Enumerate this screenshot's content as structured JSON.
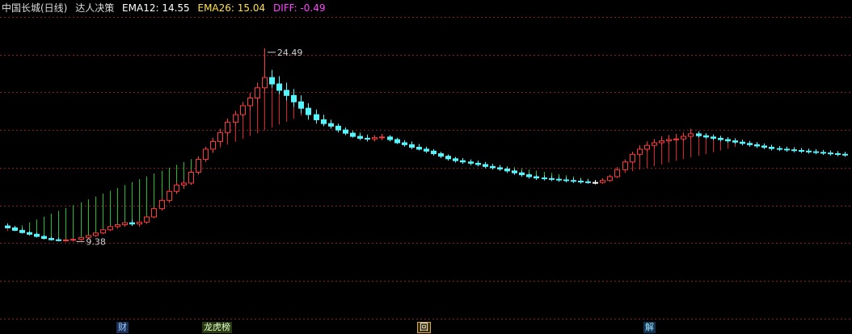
{
  "header": {
    "stock_name": "中国长城(日线)",
    "indicator_name": "达人决策",
    "ema12_text": "EMA12: 14.55",
    "ema26_text": "EMA26: 15.04",
    "diff_text": "DIFF: -0.49",
    "colors": {
      "name": "#dcdcdc",
      "ema12": "#ffffff",
      "ema26": "#ffe14d",
      "diff": "#ff44ff"
    }
  },
  "events": {
    "cai": "财",
    "bang": "龙虎榜",
    "hui": "回",
    "jie": "解"
  },
  "chart_data": {
    "type": "candlestick",
    "grid": true,
    "colors": {
      "up": "#ff3b3b",
      "down": "#54f7ff",
      "flat": "#ffffff",
      "ema_bull": "#e02020",
      "ema_bear": "#20c020",
      "grid": "#8a1e1e",
      "background": "#000000"
    },
    "ylim": [
      3.35,
      27.0
    ],
    "annotations": [
      {
        "label": "24.49",
        "index": 35,
        "value": 24.49
      },
      {
        "label": "9.38",
        "index": 9,
        "value": 9.38
      }
    ],
    "candles": [
      [
        10.6,
        10.8,
        10.4,
        10.45
      ],
      [
        10.45,
        10.6,
        10.2,
        10.25
      ],
      [
        10.25,
        10.4,
        10.0,
        10.08
      ],
      [
        10.08,
        10.2,
        9.85,
        9.95
      ],
      [
        9.95,
        10.1,
        9.7,
        9.78
      ],
      [
        9.78,
        9.9,
        9.55,
        9.62
      ],
      [
        9.62,
        9.75,
        9.45,
        9.52
      ],
      [
        9.52,
        9.7,
        9.4,
        9.45
      ],
      [
        9.45,
        9.62,
        9.38,
        9.5
      ],
      [
        9.5,
        9.65,
        9.38,
        9.55
      ],
      [
        9.55,
        9.75,
        9.45,
        9.7
      ],
      [
        9.7,
        9.9,
        9.6,
        9.85
      ],
      [
        9.85,
        10.1,
        9.75,
        10.05
      ],
      [
        10.05,
        10.4,
        9.95,
        10.3
      ],
      [
        10.3,
        10.6,
        10.2,
        10.55
      ],
      [
        10.55,
        10.8,
        10.4,
        10.7
      ],
      [
        10.7,
        10.95,
        10.55,
        10.85
      ],
      [
        10.85,
        11.1,
        10.6,
        10.75
      ],
      [
        10.75,
        11.0,
        10.55,
        10.9
      ],
      [
        10.9,
        11.4,
        10.75,
        11.3
      ],
      [
        11.3,
        12.1,
        11.2,
        11.95
      ],
      [
        11.95,
        12.8,
        11.8,
        12.6
      ],
      [
        12.6,
        13.5,
        12.4,
        13.3
      ],
      [
        13.3,
        14.0,
        13.1,
        13.8
      ],
      [
        13.8,
        14.2,
        13.5,
        13.95
      ],
      [
        13.95,
        15.0,
        13.8,
        14.8
      ],
      [
        14.8,
        16.0,
        14.6,
        15.8
      ],
      [
        15.8,
        16.8,
        15.6,
        16.6
      ],
      [
        16.6,
        17.5,
        16.3,
        17.2
      ],
      [
        17.2,
        18.2,
        16.9,
        17.9
      ],
      [
        17.9,
        19.0,
        17.6,
        18.7
      ],
      [
        18.7,
        19.6,
        18.4,
        19.3
      ],
      [
        19.3,
        20.3,
        19.0,
        20.0
      ],
      [
        20.0,
        21.0,
        19.6,
        20.6
      ],
      [
        20.6,
        21.8,
        20.2,
        21.4
      ],
      [
        21.4,
        24.49,
        21.0,
        22.2
      ],
      [
        22.2,
        22.8,
        21.4,
        21.7
      ],
      [
        21.7,
        22.3,
        20.9,
        21.2
      ],
      [
        21.2,
        21.8,
        20.4,
        20.8
      ],
      [
        20.8,
        21.3,
        19.9,
        20.3
      ],
      [
        20.3,
        20.8,
        19.4,
        19.8
      ],
      [
        19.8,
        20.2,
        18.9,
        19.3
      ],
      [
        19.3,
        19.7,
        18.6,
        18.9
      ],
      [
        18.9,
        19.3,
        18.4,
        18.6
      ],
      [
        18.6,
        18.9,
        18.2,
        18.4
      ],
      [
        18.4,
        18.6,
        17.9,
        18.1
      ],
      [
        18.1,
        18.3,
        17.7,
        17.85
      ],
      [
        17.85,
        18.0,
        17.5,
        17.6
      ],
      [
        17.6,
        17.8,
        17.3,
        17.45
      ],
      [
        17.45,
        17.7,
        17.2,
        17.4
      ],
      [
        17.4,
        17.7,
        17.2,
        17.5
      ],
      [
        17.5,
        17.8,
        17.3,
        17.55
      ],
      [
        17.55,
        17.7,
        17.2,
        17.35
      ],
      [
        17.35,
        17.5,
        17.0,
        17.1
      ],
      [
        17.1,
        17.3,
        16.8,
        16.95
      ],
      [
        16.95,
        17.2,
        16.6,
        16.75
      ],
      [
        16.75,
        17.0,
        16.5,
        16.6
      ],
      [
        16.6,
        16.8,
        16.3,
        16.45
      ],
      [
        16.45,
        16.6,
        16.1,
        16.25
      ],
      [
        16.25,
        16.4,
        15.9,
        16.05
      ],
      [
        16.05,
        16.2,
        15.7,
        15.85
      ],
      [
        15.85,
        16.0,
        15.55,
        15.7
      ],
      [
        15.7,
        15.9,
        15.45,
        15.6
      ],
      [
        15.6,
        15.8,
        15.35,
        15.5
      ],
      [
        15.5,
        15.7,
        15.25,
        15.4
      ],
      [
        15.4,
        15.6,
        15.1,
        15.25
      ],
      [
        15.25,
        15.45,
        15.0,
        15.15
      ],
      [
        15.15,
        15.35,
        14.9,
        15.05
      ],
      [
        15.05,
        15.2,
        14.75,
        14.9
      ],
      [
        14.9,
        15.05,
        14.6,
        14.75
      ],
      [
        14.75,
        14.9,
        14.45,
        14.6
      ],
      [
        14.6,
        14.75,
        14.3,
        14.45
      ],
      [
        14.45,
        14.6,
        14.2,
        14.35
      ],
      [
        14.35,
        14.55,
        14.15,
        14.3
      ],
      [
        14.3,
        14.5,
        14.1,
        14.25
      ],
      [
        14.25,
        14.45,
        14.05,
        14.2
      ],
      [
        14.2,
        14.4,
        14.0,
        14.15
      ],
      [
        14.15,
        14.35,
        13.95,
        14.1
      ],
      [
        14.1,
        14.3,
        13.9,
        14.05
      ],
      [
        14.05,
        14.25,
        13.9,
        14.0
      ],
      [
        14.0,
        14.2,
        13.85,
        14.0
      ],
      [
        14.0,
        14.3,
        13.9,
        14.15
      ],
      [
        14.15,
        14.6,
        14.05,
        14.45
      ],
      [
        14.45,
        15.2,
        14.35,
        15.0
      ],
      [
        15.0,
        15.8,
        14.9,
        15.6
      ],
      [
        15.6,
        16.4,
        15.5,
        16.2
      ],
      [
        16.2,
        16.9,
        16.0,
        16.6
      ],
      [
        16.6,
        17.2,
        16.4,
        16.9
      ],
      [
        16.9,
        17.4,
        16.7,
        17.1
      ],
      [
        17.1,
        17.6,
        16.9,
        17.25
      ],
      [
        17.25,
        17.7,
        17.0,
        17.35
      ],
      [
        17.35,
        17.8,
        17.1,
        17.4
      ],
      [
        17.4,
        17.9,
        17.2,
        17.6
      ],
      [
        17.6,
        18.2,
        17.4,
        17.8
      ],
      [
        17.8,
        18.0,
        17.5,
        17.65
      ],
      [
        17.65,
        17.85,
        17.4,
        17.55
      ],
      [
        17.55,
        17.75,
        17.3,
        17.45
      ],
      [
        17.45,
        17.65,
        17.2,
        17.35
      ],
      [
        17.35,
        17.55,
        17.1,
        17.25
      ],
      [
        17.25,
        17.45,
        17.0,
        17.15
      ],
      [
        17.15,
        17.35,
        16.9,
        17.05
      ],
      [
        17.05,
        17.25,
        16.8,
        16.95
      ],
      [
        16.95,
        17.15,
        16.7,
        16.85
      ],
      [
        16.85,
        17.05,
        16.6,
        16.75
      ],
      [
        16.75,
        16.95,
        16.5,
        16.65
      ],
      [
        16.65,
        16.85,
        16.45,
        16.6
      ],
      [
        16.6,
        16.8,
        16.4,
        16.55
      ],
      [
        16.55,
        16.75,
        16.35,
        16.5
      ],
      [
        16.5,
        16.7,
        16.3,
        16.45
      ],
      [
        16.45,
        16.65,
        16.25,
        16.4
      ],
      [
        16.4,
        16.6,
        16.2,
        16.35
      ],
      [
        16.35,
        16.55,
        16.15,
        16.3
      ],
      [
        16.3,
        16.5,
        16.1,
        16.25
      ],
      [
        16.25,
        16.45,
        16.05,
        16.2
      ],
      [
        16.2,
        16.4,
        16.0,
        16.15
      ]
    ],
    "ema": [
      {
        "x": 0,
        "y": 10.2,
        "trend": "bull"
      },
      {
        "x": 40,
        "y": 19.2,
        "trend": "bull"
      },
      {
        "x": 60,
        "y": 16.0,
        "trend": "bear"
      },
      {
        "x": 80,
        "y": 14.2,
        "trend": "bear"
      },
      {
        "x": 100,
        "y": 16.9,
        "trend": "bull"
      },
      {
        "x": 115,
        "y": 16.2,
        "trend": "bear"
      }
    ]
  }
}
